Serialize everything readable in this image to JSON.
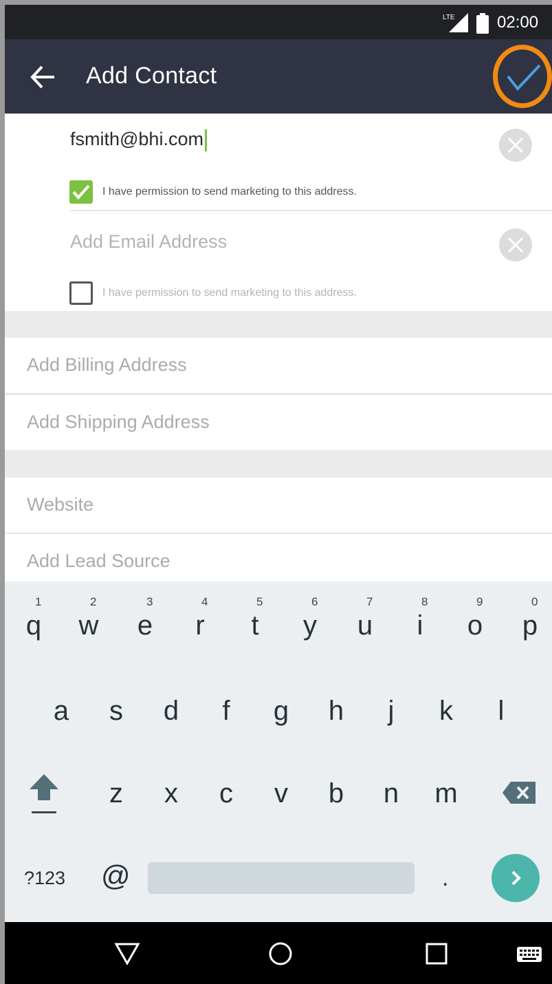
{
  "status_bar": {
    "network": "LTE",
    "time": "02:00"
  },
  "app_bar": {
    "title": "Add Contact",
    "back_icon": "arrow-left-icon",
    "save_icon": "checkmark-icon",
    "highlight_color": "#f28a13"
  },
  "emails": [
    {
      "value": "fsmith@bhi.com",
      "permission_checked": true,
      "permission_label": "I have permission to send marketing to this address."
    },
    {
      "placeholder": "Add Email Address",
      "permission_checked": false,
      "permission_label": "I have permission to send marketing to this address."
    }
  ],
  "address_rows": [
    {
      "placeholder": "Add Billing Address"
    },
    {
      "placeholder": "Add Shipping Address"
    }
  ],
  "other_rows": [
    {
      "placeholder": "Website"
    },
    {
      "placeholder": "Add Lead Source"
    }
  ],
  "keyboard": {
    "row1": [
      {
        "char": "q",
        "hint": "1"
      },
      {
        "char": "w",
        "hint": "2"
      },
      {
        "char": "e",
        "hint": "3"
      },
      {
        "char": "r",
        "hint": "4"
      },
      {
        "char": "t",
        "hint": "5"
      },
      {
        "char": "y",
        "hint": "6"
      },
      {
        "char": "u",
        "hint": "7"
      },
      {
        "char": "i",
        "hint": "8"
      },
      {
        "char": "o",
        "hint": "9"
      },
      {
        "char": "p",
        "hint": "0"
      }
    ],
    "row2": [
      "a",
      "s",
      "d",
      "f",
      "g",
      "h",
      "j",
      "k",
      "l"
    ],
    "row3": [
      "z",
      "x",
      "c",
      "v",
      "b",
      "n",
      "m"
    ],
    "symbols_label": "?123",
    "at_label": "@",
    "period_label": ".",
    "shift_icon": "shift-icon",
    "backspace_icon": "backspace-icon",
    "go_icon": "chevron-right-icon",
    "accent": "#4db6ac"
  },
  "nav_bar": {
    "back_icon": "triangle-back-icon",
    "home_icon": "circle-home-icon",
    "recents_icon": "square-recents-icon",
    "keyboard_icon": "keyboard-icon"
  },
  "colors": {
    "app_bar": "#2f3343",
    "status_bar": "#1f2125",
    "checkbox_checked": "#7cc142",
    "checkmark": "#4a9fe0"
  }
}
